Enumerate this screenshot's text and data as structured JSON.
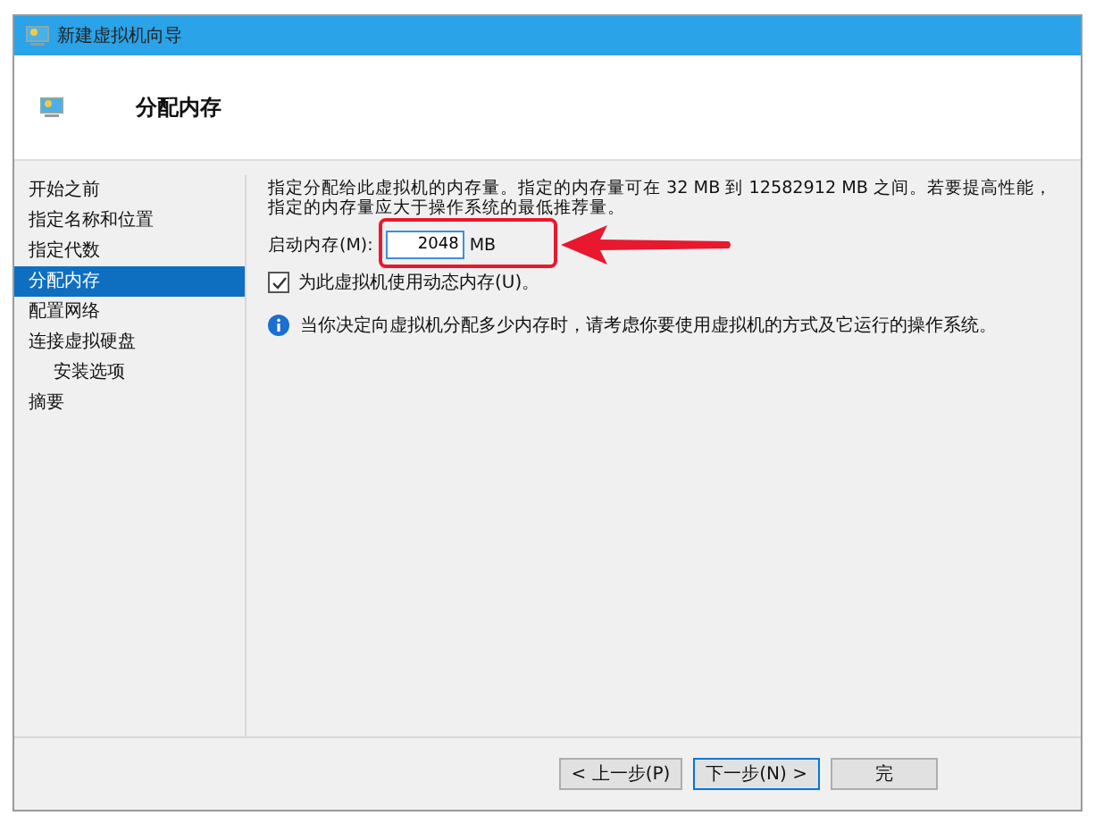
{
  "window": {
    "title": "新建虚拟机向导"
  },
  "header": {
    "title": "分配内存"
  },
  "steps": [
    {
      "label": "开始之前",
      "selected": false
    },
    {
      "label": "指定名称和位置",
      "selected": false
    },
    {
      "label": "指定代数",
      "selected": false
    },
    {
      "label": "分配内存",
      "selected": true
    },
    {
      "label": "配置网络",
      "selected": false
    },
    {
      "label": "连接虚拟硬盘",
      "selected": false,
      "children": [
        {
          "label": "安装选项",
          "selected": false
        }
      ]
    },
    {
      "label": "摘要",
      "selected": false
    }
  ],
  "memory": {
    "description": "指定分配给此虚拟机的内存量。指定的内存量可在 32 MB 到 12582912 MB 之间。若要提高性能，指定的内存量应大于操作系统的最低推荐量。",
    "startup_label": "启动内存(M):",
    "startup_value": "2048",
    "unit": "MB",
    "dynamic": {
      "label": "为此虚拟机使用动态内存(U)。",
      "checked": true
    },
    "info": "当你决定向虚拟机分配多少内存时，请考虑你要使用虚拟机的方式及它运行的操作系统。"
  },
  "buttons": [
    {
      "label": "< 上一步(P)",
      "default": false
    },
    {
      "label": "下一步(N) >",
      "default": true
    },
    {
      "label": "完",
      "default": false
    }
  ]
}
